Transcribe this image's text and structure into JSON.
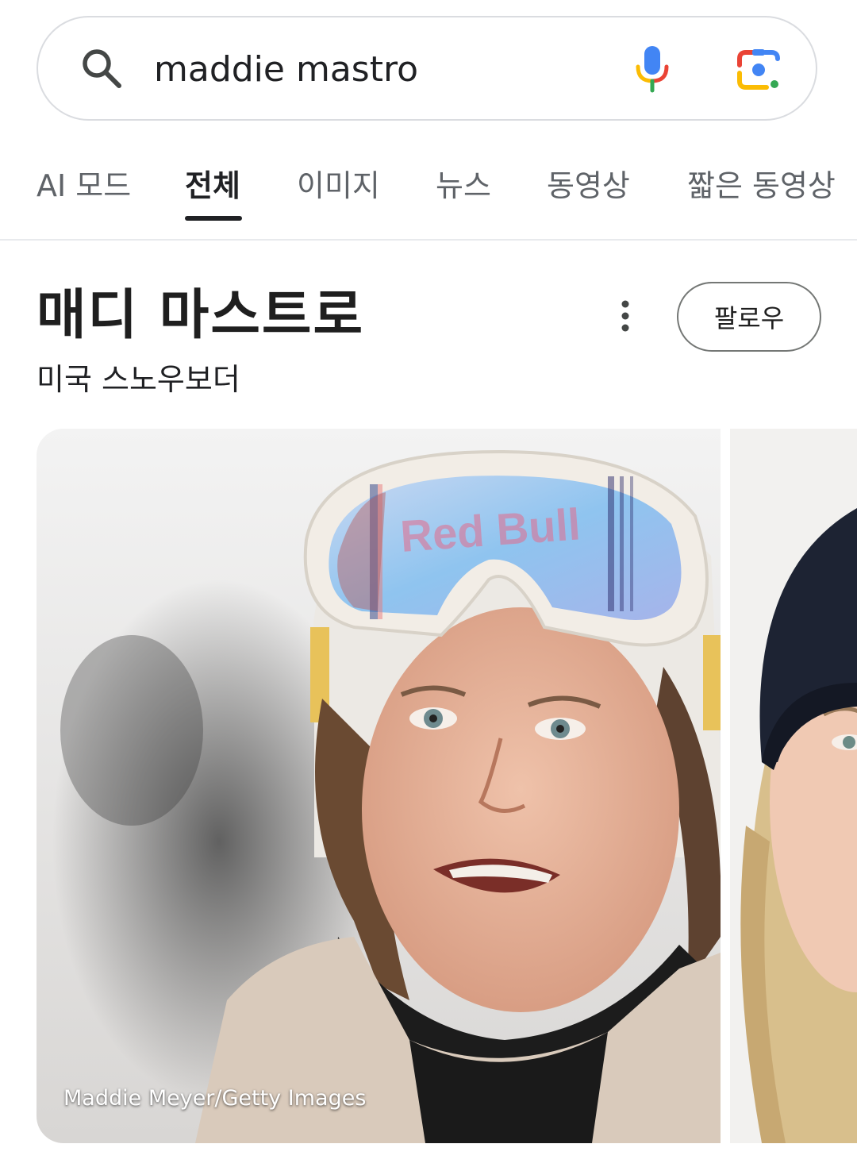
{
  "search": {
    "query": "maddie mastro"
  },
  "icons": {
    "search": "search-icon",
    "mic": "mic-icon",
    "lens": "google-lens-icon",
    "more": "more-vertical-icon"
  },
  "tabs": [
    {
      "label": "AI 모드",
      "active": false
    },
    {
      "label": "전체",
      "active": true
    },
    {
      "label": "이미지",
      "active": false
    },
    {
      "label": "뉴스",
      "active": false
    },
    {
      "label": "동영상",
      "active": false
    },
    {
      "label": "짧은 동영상",
      "active": false
    }
  ],
  "entity": {
    "title": "매디 마스트로",
    "subtitle": "미국 스노우보더",
    "follow_label": "팔로우"
  },
  "images": {
    "main_credit": "Maddie Meyer/Getty Images"
  },
  "colors": {
    "google_blue": "#4285F4",
    "google_red": "#EA4335",
    "google_yellow": "#FBBC04",
    "google_green": "#34A853"
  }
}
